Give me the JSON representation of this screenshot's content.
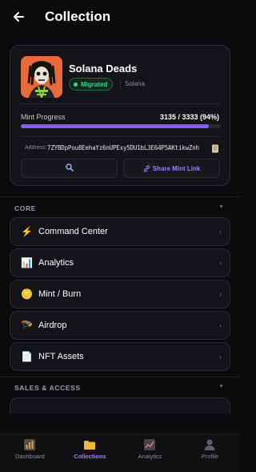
{
  "header": {
    "title": "Collection"
  },
  "collection": {
    "name": "Solana Deads",
    "status": "Migrated",
    "chain": "Solana",
    "mint_progress_label": "Mint Progress",
    "mint_count": "3135 / 3333 (94%)",
    "mint_fraction": 0.94,
    "address_label": "Address:",
    "address": "7ZYBDpPou8EehaYz6nUPExy5DU1bL3E64P5AKtikwZnh",
    "share_label": "Share Mint Link"
  },
  "sections": [
    {
      "title": "CORE",
      "caret": "▼"
    },
    {
      "title": "SALES & ACCESS",
      "caret": "▼"
    }
  ],
  "menu": [
    {
      "label": "Command Center",
      "icon": "lightning-icon",
      "glyph": "⚡",
      "chevron": "›"
    },
    {
      "label": "Analytics",
      "icon": "bar-chart-icon",
      "glyph": "📊",
      "chevron": "›"
    },
    {
      "label": "Mint / Burn",
      "icon": "coin-icon",
      "glyph": "🪙",
      "chevron": "›"
    },
    {
      "label": "Airdrop",
      "icon": "parachute-icon",
      "glyph": "🪂",
      "chevron": "›"
    },
    {
      "label": "NFT Assets",
      "icon": "document-icon",
      "glyph": "📄",
      "chevron": "›"
    }
  ],
  "tabs": [
    {
      "label": "Dashboard",
      "icon": "dashboard-icon"
    },
    {
      "label": "Collections",
      "icon": "folder-icon",
      "active": true
    },
    {
      "label": "Analytics",
      "icon": "chart-line-icon"
    },
    {
      "label": "Profile",
      "icon": "profile-icon"
    }
  ],
  "colors": {
    "accent": "#8a5cf6",
    "success": "#3fd68a",
    "background": "#0b0b0e",
    "card": "#141418"
  }
}
